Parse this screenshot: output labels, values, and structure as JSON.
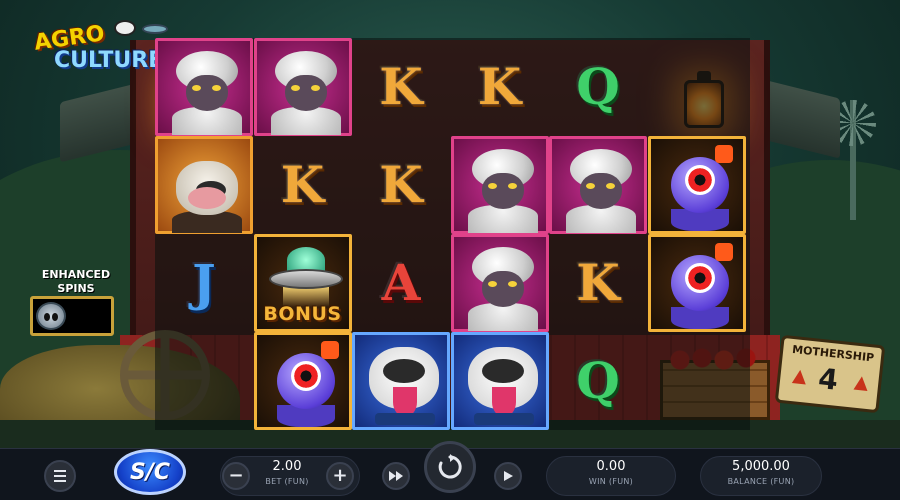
{
  "game": {
    "logo_line1": "AGRO",
    "logo_line2": "CULTURE"
  },
  "enhanced_spins": {
    "title_line1": "ENHANCED",
    "title_line2": "SPINS"
  },
  "reels": {
    "columns": [
      [
        "sheep",
        "cow",
        "J",
        "blank"
      ],
      [
        "sheep",
        "K",
        "bonus",
        "alien"
      ],
      [
        "K",
        "K",
        "A",
        "dog"
      ],
      [
        "K",
        "sheep",
        "sheep",
        "dog"
      ],
      [
        "Q",
        "sheep",
        "K",
        "Q"
      ],
      [
        "blank",
        "alien",
        "alien",
        "blank"
      ]
    ]
  },
  "bonus_symbol": {
    "label": "BONUS"
  },
  "sign": {
    "label": "MOTHERSHIP",
    "number": "4"
  },
  "controls": {
    "sc_label": "S/C",
    "minus": "−",
    "plus": "+",
    "bet_value": "2.00",
    "bet_label": "BET (FUN)",
    "win_value": "0.00",
    "win_label": "WIN (FUN)",
    "balance_value": "5,000.00",
    "balance_label": "BALANCE (FUN)"
  },
  "icons": {
    "menu": "hamburger-menu-icon",
    "fast_forward": "fast-forward-icon",
    "spin": "spin-refresh-icon",
    "autoplay": "play-icon",
    "enhanced": "alien-head-icon"
  },
  "colors": {
    "sc_button": "#1440c8",
    "bar_background": "#10151d",
    "bonus_text": "#f5b63a"
  }
}
